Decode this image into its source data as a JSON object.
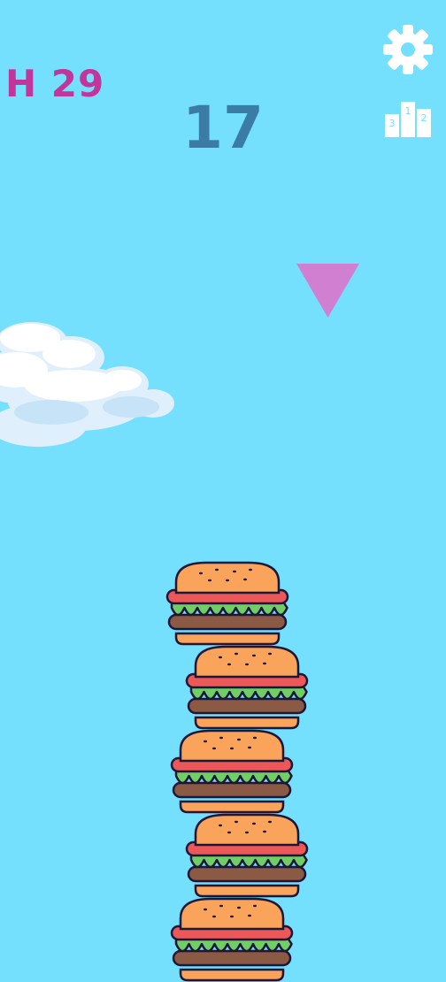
{
  "hud": {
    "high_score_label": "H 29",
    "score": "17"
  },
  "icons": {
    "settings": "gear-icon",
    "leaderboard": "podium-icon"
  },
  "leaderboard_icon": {
    "rank_1": "1",
    "rank_2": "2",
    "rank_3": "3"
  },
  "colors": {
    "sky": "#75dffe",
    "high_score": "#c2359a",
    "score": "#3a7ca5",
    "drop_marker": "#d17fd1",
    "bun": "#f9a45a",
    "tomato": "#ec5858",
    "lettuce": "#6fcf64",
    "patty": "#8a5a44",
    "outline": "#1c1638"
  },
  "stack": {
    "burger_count": 5
  }
}
